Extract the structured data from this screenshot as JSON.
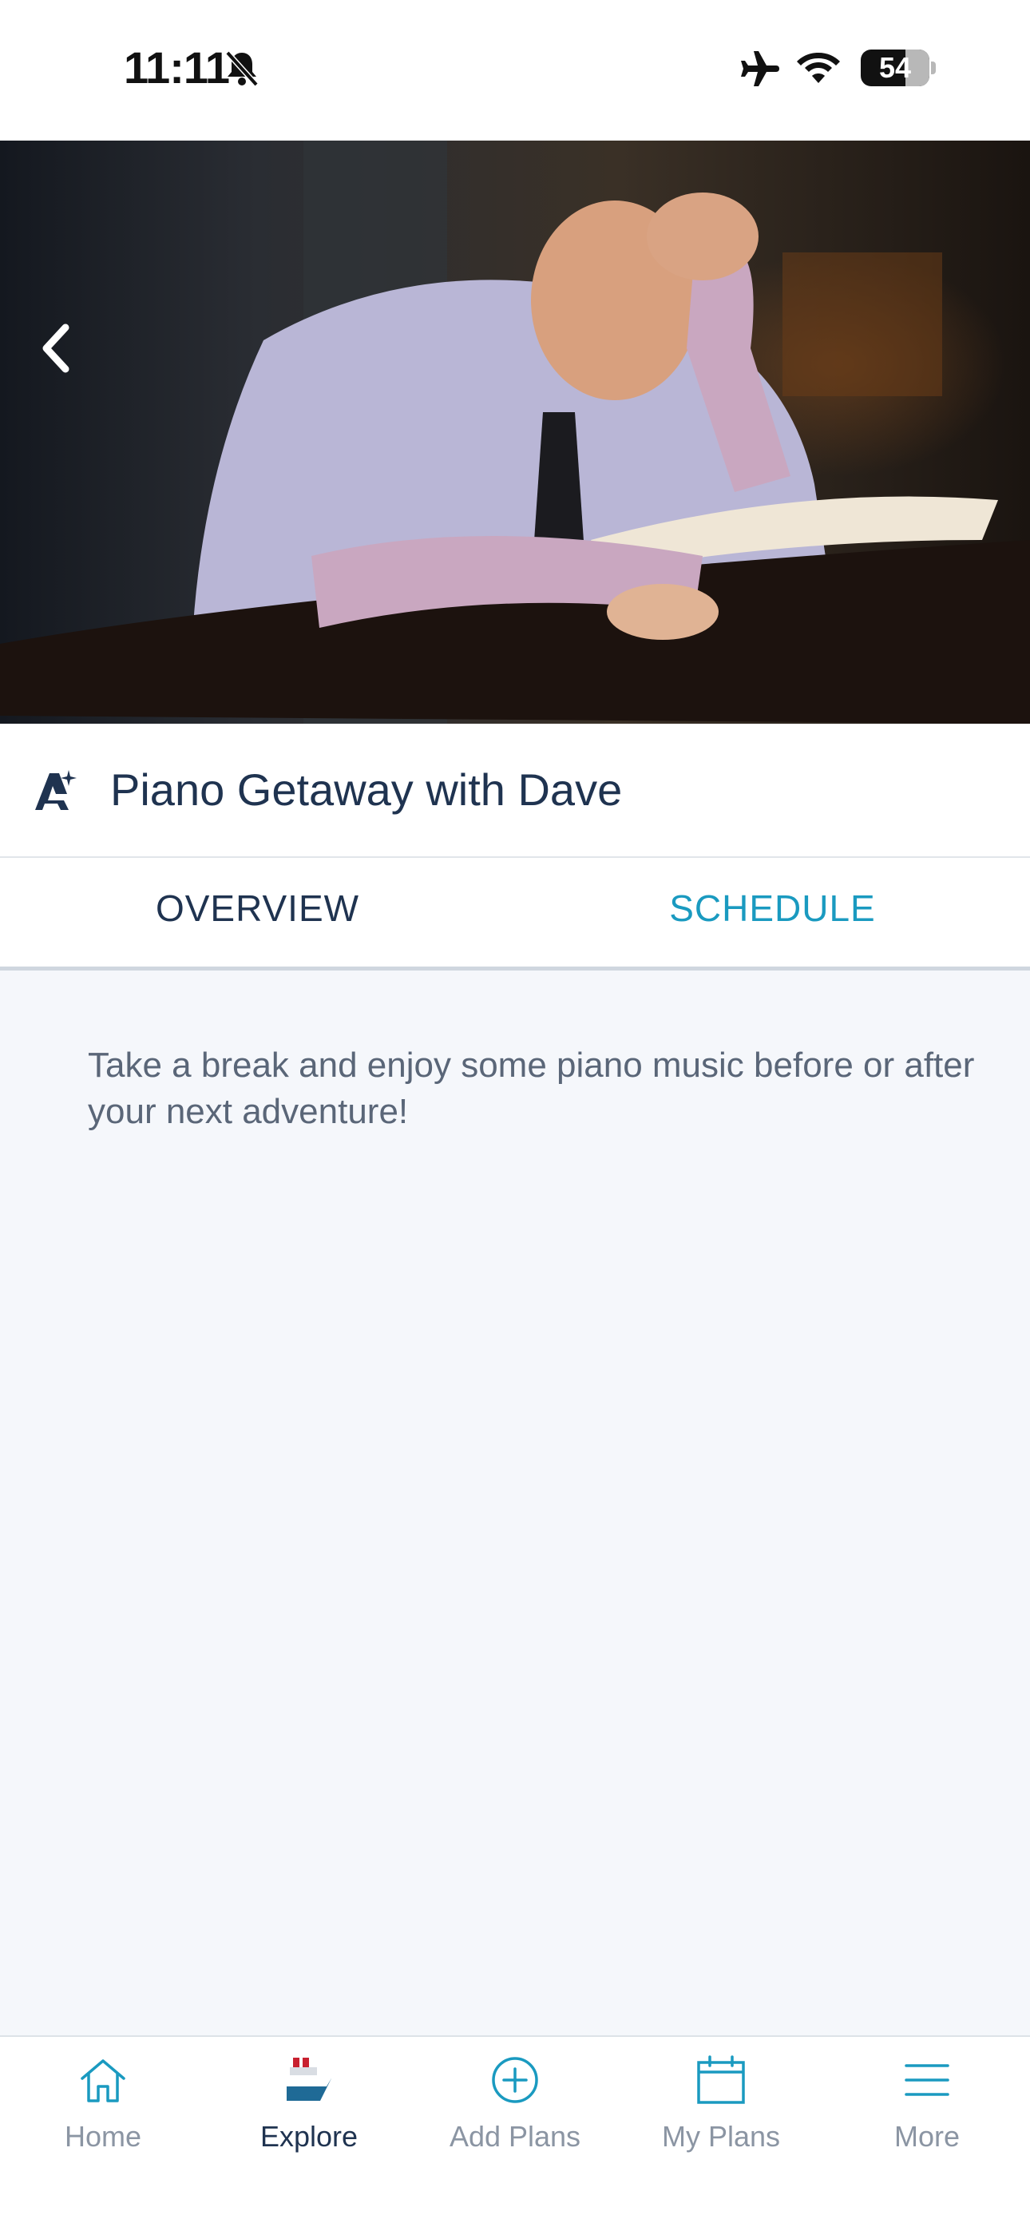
{
  "status_bar": {
    "time": "11:11",
    "battery": "54"
  },
  "hero": {
    "back_icon": "chevron-left-icon",
    "image_description_icon": "photo-pianist"
  },
  "event": {
    "icon": "entertainment-icon",
    "title": "Piano Getaway with Dave"
  },
  "tabs": [
    {
      "label": "OVERVIEW",
      "active": true
    },
    {
      "label": "SCHEDULE",
      "active": false
    }
  ],
  "overview": {
    "description": "Take a break and enjoy some piano music before or after your next adventure!"
  },
  "bottom_nav": [
    {
      "label": "Home",
      "icon": "home-icon",
      "active": false
    },
    {
      "label": "Explore",
      "icon": "ship-icon",
      "active": true
    },
    {
      "label": "Add Plans",
      "icon": "plus-circle-icon",
      "active": false
    },
    {
      "label": "My Plans",
      "icon": "calendar-icon",
      "active": false
    },
    {
      "label": "More",
      "icon": "menu-icon",
      "active": false
    }
  ],
  "colors": {
    "accent": "#1a9ac0",
    "text_primary": "#1f3350",
    "background": "#f5f7fb"
  }
}
